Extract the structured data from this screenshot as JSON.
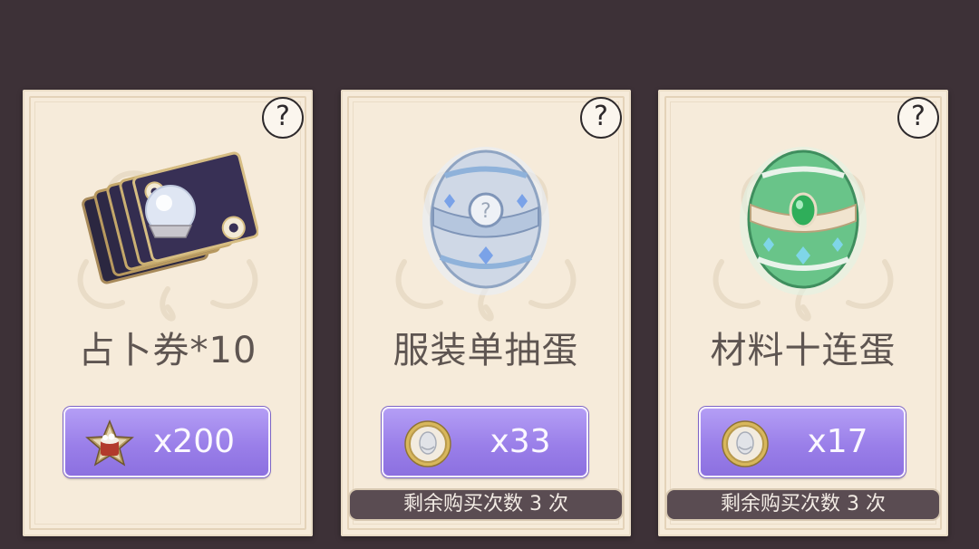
{
  "colors": {
    "background": "#3d3137",
    "card": "#f6ebda",
    "button_purple": "#9a7fe9",
    "remaining_bar": "#5a4c52",
    "name_text": "#5e5551"
  },
  "cards": [
    {
      "help_label": "?",
      "item_icon": "tarot-cards-crystal-ball-icon",
      "name": "占卜券*10",
      "currency_icon": "star-drum-badge-icon",
      "price": "x200",
      "remaining": ""
    },
    {
      "help_label": "?",
      "item_icon": "silver-blue-egg-icon",
      "name": "服装单抽蛋",
      "currency_icon": "gold-coin-icon",
      "price": "x33",
      "remaining": "剩余购买次数 3 次"
    },
    {
      "help_label": "?",
      "item_icon": "green-jade-egg-icon",
      "name": "材料十连蛋",
      "currency_icon": "gold-coin-icon",
      "price": "x17",
      "remaining": "剩余购买次数 3 次"
    }
  ]
}
